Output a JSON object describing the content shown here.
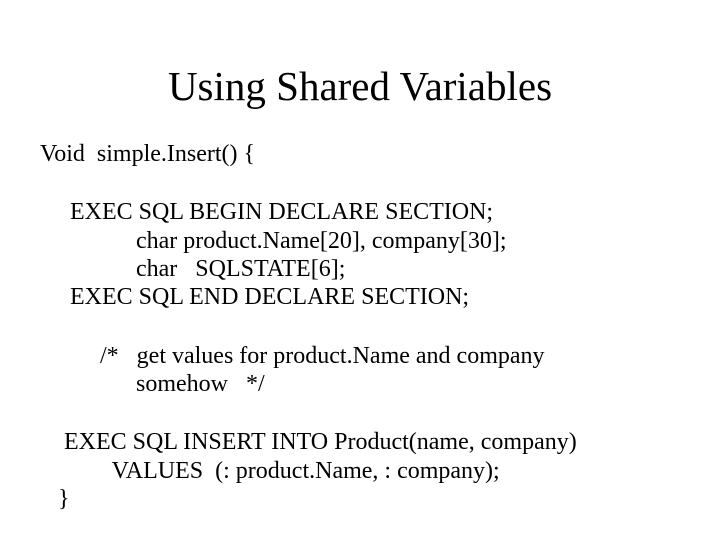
{
  "title": "Using Shared Variables",
  "fn_sig": "Void  simple.Insert() {",
  "decl": {
    "begin": "     EXEC SQL BEGIN DECLARE SECTION;",
    "name": "                char product.Name[20], company[30];",
    "state": "                char   SQLSTATE[6];",
    "end": "     EXEC SQL END DECLARE SECTION;"
  },
  "comment": {
    "l1": "          /*   get values for product.Name and company",
    "l2": "                somehow   */"
  },
  "insert": {
    "l1": "    EXEC SQL INSERT INTO Product(name, company)",
    "l2": "            VALUES  (: product.Name, : company);"
  },
  "close": "   }"
}
